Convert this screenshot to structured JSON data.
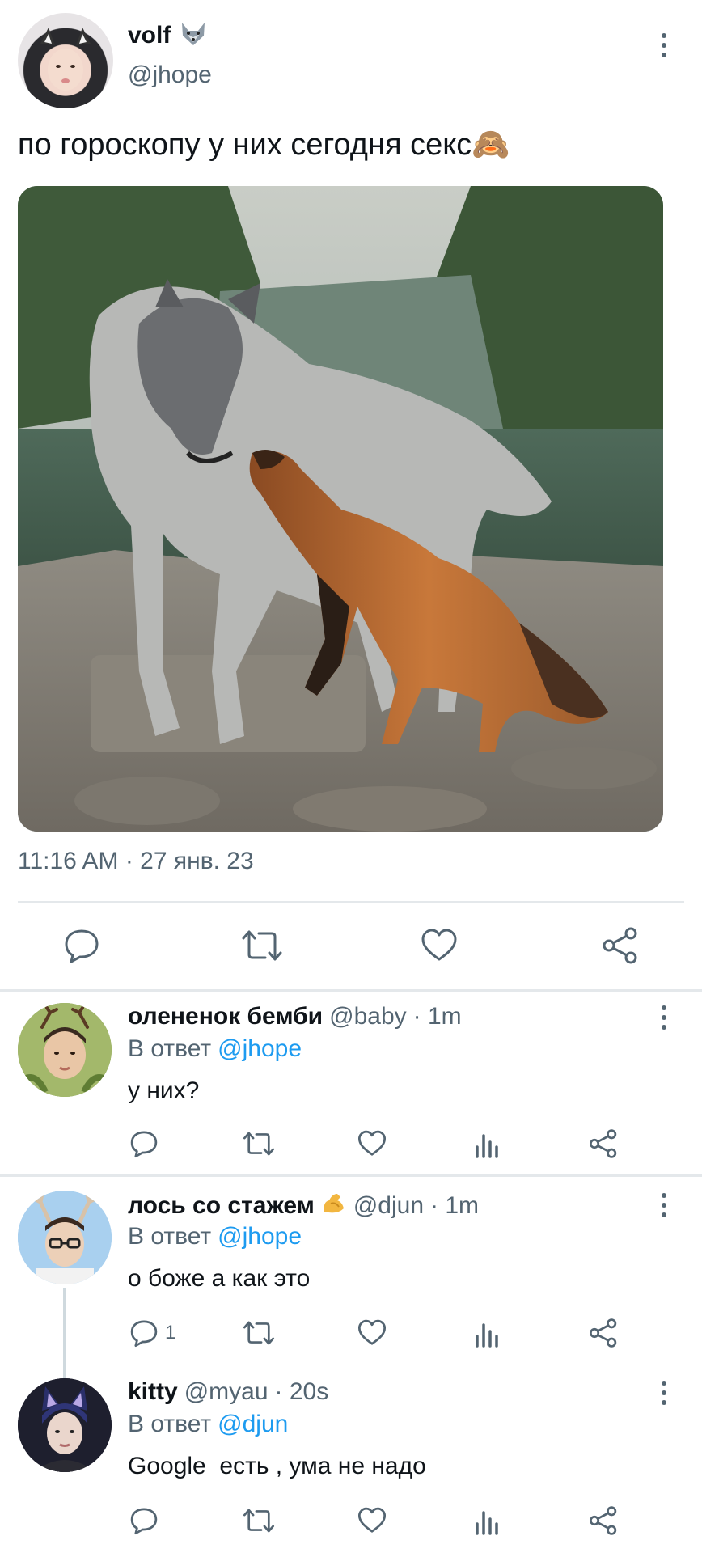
{
  "tweet": {
    "author_name": "volf",
    "author_handle": "@jhope",
    "text": "по гороскопу  у них сегодня секс🙈",
    "timestamp": "11:16 AM · 27 янв. 23"
  },
  "replies": [
    {
      "name": "олененок бемби",
      "handle": "@baby",
      "time": "· 1m",
      "reply_prefix": "В ответ",
      "reply_to": "@jhope",
      "text": "у них?",
      "reply_count": ""
    },
    {
      "name": "лось со стажем",
      "handle": "@djun",
      "time": "· 1m",
      "reply_prefix": "В ответ",
      "reply_to": "@jhope",
      "text": "о боже а как это",
      "reply_count": "1"
    },
    {
      "name": "kitty",
      "handle": "@myau",
      "time": "· 20s",
      "reply_prefix": "В ответ",
      "reply_to": "@djun",
      "text": "Google  есть , ума не надо",
      "reply_count": ""
    }
  ],
  "icons": {
    "reply": "reply-icon",
    "retweet": "retweet-icon",
    "like": "like-icon",
    "share": "share-icon",
    "views": "views-icon",
    "more": "more-icon"
  },
  "colors": {
    "text": "#0f1419",
    "muted": "#536471",
    "link": "#1d9bf0",
    "divider": "#e4e8eb"
  }
}
